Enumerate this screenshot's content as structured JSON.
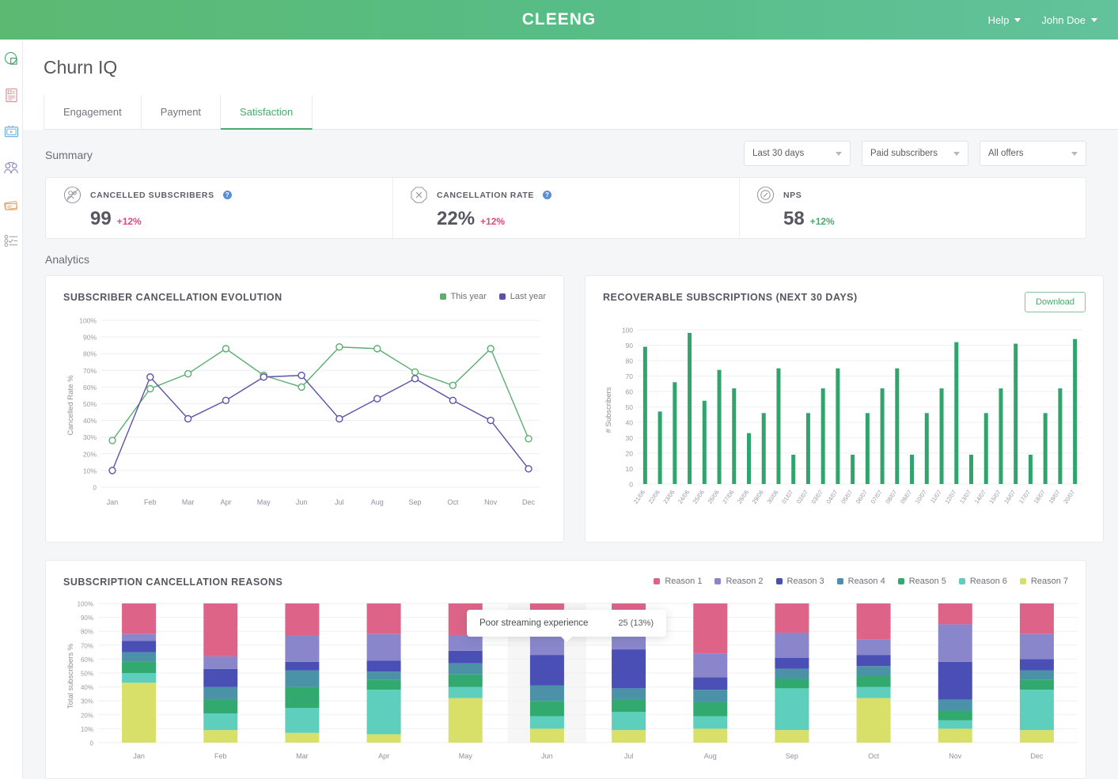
{
  "topbar": {
    "brand": "CLEENG",
    "help_label": "Help",
    "user_label": "John Doe"
  },
  "sidebar": {
    "items": [
      {
        "name": "dashboard-icon",
        "label": "Dashboard",
        "color": "#4aa96c"
      },
      {
        "name": "reports-icon",
        "label": "Reports",
        "color": "#d98b96"
      },
      {
        "name": "media-icon",
        "label": "Media",
        "color": "#6aa7d8"
      },
      {
        "name": "audience-icon",
        "label": "Audience",
        "color": "#8d86c9"
      },
      {
        "name": "offers-icon",
        "label": "Offers",
        "color": "#e3a567"
      },
      {
        "name": "tasks-icon",
        "label": "Tasks",
        "color": "#9fa3ad"
      }
    ]
  },
  "page": {
    "title": "Churn IQ",
    "tabs": [
      {
        "label": "Engagement",
        "active": false
      },
      {
        "label": "Payment",
        "active": false
      },
      {
        "label": "Satisfaction",
        "active": true
      }
    ]
  },
  "summary": {
    "label": "Summary",
    "filters": [
      {
        "name": "date-range-select",
        "value": "Last 30 days"
      },
      {
        "name": "subscriber-type-select",
        "value": "Paid subscribers"
      },
      {
        "name": "offers-select",
        "value": "All offers"
      }
    ],
    "cards": [
      {
        "name": "cancelled-subscribers",
        "title": "CANCELLED SUBSCRIBERS",
        "value": "99",
        "delta": "+12%",
        "delta_type": "negative",
        "has_help": true,
        "icon": "cancelled-subscribers-icon"
      },
      {
        "name": "cancellation-rate",
        "title": "CANCELLATION RATE",
        "value": "22%",
        "delta": "+12%",
        "delta_type": "negative",
        "has_help": true,
        "icon": "cancellation-rate-icon"
      },
      {
        "name": "nps",
        "title": "NPS",
        "value": "58",
        "delta": "+12%",
        "delta_type": "positive",
        "has_help": false,
        "icon": "nps-icon"
      }
    ]
  },
  "analytics": {
    "label": "Analytics",
    "download_label": "Download"
  },
  "tooltip": {
    "label": "Poor streaming experience",
    "value": "25 (13%)"
  },
  "colors": {
    "green": "#4aa96c",
    "purple": "#5b53a8",
    "bar_green": "#30a46c",
    "accent_pink": "#e2487a"
  },
  "chart_data": [
    {
      "name": "subscriber-cancellation-evolution",
      "type": "line",
      "title": "SUBSCRIBER CANCELLATION EVOLUTION",
      "xlabel": "",
      "ylabel": "Cancelled Rate %",
      "ylim": [
        0,
        100
      ],
      "yticks": [
        "0",
        "10%",
        "20%",
        "30%",
        "40%",
        "50%",
        "60%",
        "70%",
        "80%",
        "90%",
        "100%"
      ],
      "categories": [
        "Jan",
        "Feb",
        "Mar",
        "Apr",
        "May",
        "Jun",
        "Jul",
        "Aug",
        "Sep",
        "Oct",
        "Nov",
        "Dec"
      ],
      "legend_position": "top-right",
      "grid": true,
      "series": [
        {
          "name": "This year",
          "color": "#5cae70",
          "values": [
            28,
            59,
            68,
            83,
            67,
            60,
            84,
            83,
            69,
            61,
            83,
            29
          ]
        },
        {
          "name": "Last year",
          "color": "#5b53a8",
          "values": [
            10,
            66,
            41,
            52,
            66,
            67,
            41,
            53,
            65,
            52,
            40,
            11
          ]
        }
      ]
    },
    {
      "name": "recoverable-subscriptions",
      "type": "bar",
      "title": "RECOVERABLE SUBSCRIPTIONS (NEXT 30 DAYS)",
      "xlabel": "",
      "ylabel": "# Subscribers",
      "ylim": [
        0,
        100
      ],
      "yticks": [
        "0",
        "10",
        "20",
        "30",
        "40",
        "50",
        "60",
        "70",
        "80",
        "90",
        "100"
      ],
      "grid": true,
      "bar_color": "#30a46c",
      "categories": [
        "21/06",
        "22/06",
        "23/06",
        "24/06",
        "25/06",
        "26/06",
        "27/06",
        "28/06",
        "29/06",
        "30/06",
        "01/07",
        "02/07",
        "03/07",
        "04/07",
        "05/07",
        "06/07",
        "07/07",
        "08/07",
        "09/07",
        "10/07",
        "11/07",
        "12/07",
        "13/07",
        "14/07",
        "15/07",
        "16/07",
        "17/07",
        "18/07",
        "19/07",
        "20/07"
      ],
      "values": [
        89,
        47,
        66,
        98,
        54,
        74,
        62,
        33,
        46,
        75,
        19,
        46,
        62,
        75,
        19,
        46,
        62,
        75,
        19,
        46,
        62,
        92,
        19,
        46,
        62,
        91,
        19,
        46,
        62,
        94
      ]
    },
    {
      "name": "subscription-cancellation-reasons",
      "type": "bar",
      "stacked": true,
      "title": "SUBSCRIPTION CANCELLATION REASONS",
      "xlabel": "",
      "ylabel": "Total subscribers %",
      "ylim": [
        0,
        100
      ],
      "yticks": [
        "0",
        "10%",
        "20%",
        "30%",
        "40%",
        "50%",
        "60%",
        "70%",
        "80%",
        "90%",
        "100%"
      ],
      "grid": true,
      "legend_position": "top-right",
      "categories": [
        "Jan",
        "Feb",
        "Mar",
        "Apr",
        "May",
        "Jun",
        "Jul",
        "Aug",
        "Sep",
        "Oct",
        "Nov",
        "Dec"
      ],
      "highlighted_category": "Jun",
      "series": [
        {
          "name": "Reason 7",
          "color": "#d8e06a",
          "values": [
            43,
            9,
            7,
            6,
            32,
            10,
            9,
            10,
            9,
            32,
            10,
            9
          ]
        },
        {
          "name": "Reason 6",
          "color": "#5ecfbd",
          "values": [
            7,
            12,
            18,
            32,
            8,
            9,
            13,
            9,
            30,
            8,
            6,
            29
          ]
        },
        {
          "name": "Reason 5",
          "color": "#32a96e",
          "values": [
            8,
            10,
            15,
            7,
            9,
            11,
            9,
            10,
            7,
            8,
            7,
            7
          ]
        },
        {
          "name": "Reason 4",
          "color": "#4b92a8",
          "values": [
            7,
            9,
            12,
            6,
            8,
            11,
            8,
            9,
            7,
            7,
            8,
            7
          ]
        },
        {
          "name": "Reason 3",
          "color": "#4a4fb5",
          "values": [
            8,
            13,
            6,
            8,
            9,
            22,
            28,
            9,
            8,
            8,
            27,
            8
          ]
        },
        {
          "name": "Reason 2",
          "color": "#8a86cc",
          "values": [
            5,
            9,
            19,
            19,
            11,
            25,
            20,
            17,
            18,
            11,
            27,
            18
          ]
        },
        {
          "name": "Reason 1",
          "color": "#dd6488",
          "values": [
            22,
            38,
            23,
            22,
            23,
            12,
            13,
            36,
            21,
            26,
            15,
            22
          ]
        }
      ]
    }
  ]
}
